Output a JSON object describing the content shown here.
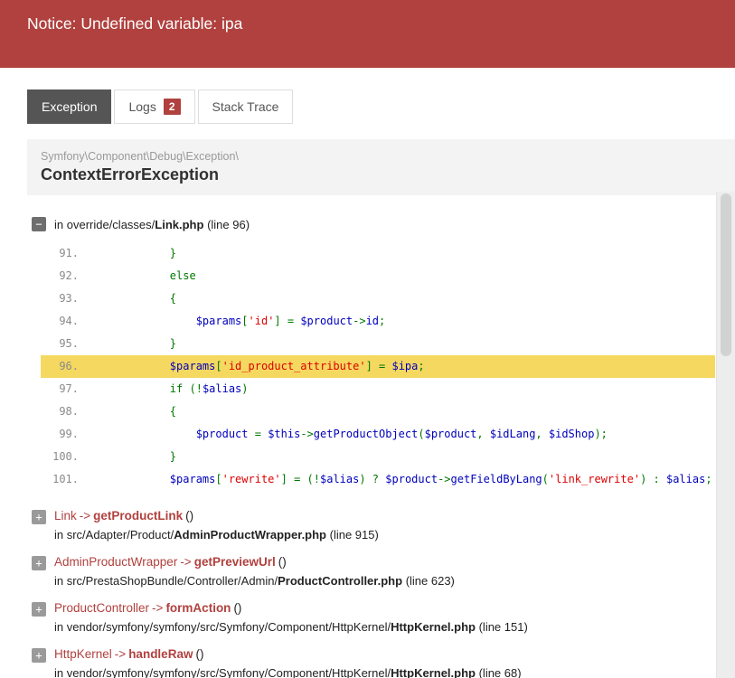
{
  "banner": {
    "message": "Notice: Undefined variable: ipa"
  },
  "tabs": [
    {
      "label": "Exception",
      "active": true
    },
    {
      "label": "Logs",
      "active": false,
      "badge": "2"
    },
    {
      "label": "Stack Trace",
      "active": false
    }
  ],
  "exception": {
    "namespace": "Symfony\\Component\\Debug\\Exception\\",
    "name": "ContextErrorException"
  },
  "source": {
    "toggle_icon": "minus-icon",
    "location": {
      "prefix": "in override/classes/",
      "file": "Link.php",
      "suffix": " (line 96)"
    }
  },
  "code": {
    "highlight_line": "96",
    "lines": [
      {
        "no": "91.",
        "tokens": [
          {
            "text": "        }",
            "type": "kw"
          }
        ]
      },
      {
        "no": "92.",
        "tokens": [
          {
            "text": "        else",
            "type": "kw"
          }
        ]
      },
      {
        "no": "93.",
        "tokens": [
          {
            "text": "        {",
            "type": "kw"
          }
        ]
      },
      {
        "no": "94.",
        "tokens": [
          {
            "text": "            ",
            "type": "kw"
          },
          {
            "text": "$params",
            "type": "var"
          },
          {
            "text": "[",
            "type": "kw"
          },
          {
            "text": "'id'",
            "type": "str"
          },
          {
            "text": "] = ",
            "type": "kw"
          },
          {
            "text": "$product",
            "type": "var"
          },
          {
            "text": "->",
            "type": "kw"
          },
          {
            "text": "id",
            "type": "var"
          },
          {
            "text": ";",
            "type": "kw"
          }
        ]
      },
      {
        "no": "95.",
        "tokens": [
          {
            "text": "        }",
            "type": "kw"
          }
        ]
      },
      {
        "no": "96.",
        "highlight": true,
        "tokens": [
          {
            "text": "        ",
            "type": "kw"
          },
          {
            "text": "$params",
            "type": "var"
          },
          {
            "text": "[",
            "type": "kw"
          },
          {
            "text": "'id_product_attribute'",
            "type": "str"
          },
          {
            "text": "] = ",
            "type": "kw"
          },
          {
            "text": "$ipa",
            "type": "var"
          },
          {
            "text": ";",
            "type": "kw"
          }
        ]
      },
      {
        "no": "97.",
        "tokens": [
          {
            "text": "        ",
            "type": "kw"
          },
          {
            "text": "if",
            "type": "kw"
          },
          {
            "text": " (!",
            "type": "kw"
          },
          {
            "text": "$alias",
            "type": "var"
          },
          {
            "text": ")",
            "type": "kw"
          }
        ]
      },
      {
        "no": "98.",
        "tokens": [
          {
            "text": "        {",
            "type": "kw"
          }
        ]
      },
      {
        "no": "99.",
        "tokens": [
          {
            "text": "            ",
            "type": "kw"
          },
          {
            "text": "$product",
            "type": "var"
          },
          {
            "text": " = ",
            "type": "kw"
          },
          {
            "text": "$this",
            "type": "var"
          },
          {
            "text": "->",
            "type": "kw"
          },
          {
            "text": "getProductObject",
            "type": "var"
          },
          {
            "text": "(",
            "type": "kw"
          },
          {
            "text": "$product",
            "type": "var"
          },
          {
            "text": ", ",
            "type": "kw"
          },
          {
            "text": "$idLang",
            "type": "var"
          },
          {
            "text": ", ",
            "type": "kw"
          },
          {
            "text": "$idShop",
            "type": "var"
          },
          {
            "text": ");",
            "type": "kw"
          }
        ]
      },
      {
        "no": "100.",
        "tokens": [
          {
            "text": "        }",
            "type": "kw"
          }
        ]
      },
      {
        "no": "101.",
        "tokens": [
          {
            "text": "        ",
            "type": "kw"
          },
          {
            "text": "$params",
            "type": "var"
          },
          {
            "text": "[",
            "type": "kw"
          },
          {
            "text": "'rewrite'",
            "type": "str"
          },
          {
            "text": "] = (!",
            "type": "kw"
          },
          {
            "text": "$alias",
            "type": "var"
          },
          {
            "text": ") ? ",
            "type": "kw"
          },
          {
            "text": "$product",
            "type": "var"
          },
          {
            "text": "->",
            "type": "kw"
          },
          {
            "text": "getFieldByLang",
            "type": "var"
          },
          {
            "text": "(",
            "type": "kw"
          },
          {
            "text": "'link_rewrite'",
            "type": "str"
          },
          {
            "text": ") : ",
            "type": "kw"
          },
          {
            "text": "$alias",
            "type": "var"
          },
          {
            "text": ";",
            "type": "kw"
          }
        ]
      }
    ]
  },
  "frames": [
    {
      "class": "Link",
      "arrow": "->",
      "method": "getProductLink",
      "args": "()",
      "toggle_icon": "plus-icon",
      "location": {
        "prefix": "in src/Adapter/Product/",
        "file": "AdminProductWrapper.php",
        "suffix": " (line 915)"
      }
    },
    {
      "class": "AdminProductWrapper",
      "arrow": "->",
      "method": "getPreviewUrl",
      "args": "()",
      "toggle_icon": "plus-icon",
      "location": {
        "prefix": "in src/PrestaShopBundle/Controller/Admin/",
        "file": "ProductController.php",
        "suffix": " (line 623)"
      }
    },
    {
      "class": "ProductController",
      "arrow": "->",
      "method": "formAction",
      "args": "()",
      "toggle_icon": "plus-icon",
      "location": {
        "prefix": "in vendor/symfony/symfony/src/Symfony/Component/HttpKernel/",
        "file": "HttpKernel.php",
        "suffix": " (line 151)"
      }
    },
    {
      "class": "HttpKernel",
      "arrow": "->",
      "method": "handleRaw",
      "args": "()",
      "toggle_icon": "plus-icon",
      "location": {
        "prefix": "in vendor/symfony/symfony/src/Symfony/Component/HttpKernel/",
        "file": "HttpKernel.php",
        "suffix": " (line 68)"
      }
    }
  ],
  "colors": {
    "banner": "#B0413E",
    "tab_active_bg": "#555555",
    "badge": "#B0413E",
    "highlight": "#F5D860",
    "code_keyword": "#007700",
    "code_default": "#0000BB",
    "code_string": "#DD0000",
    "method": "#B0413E"
  }
}
